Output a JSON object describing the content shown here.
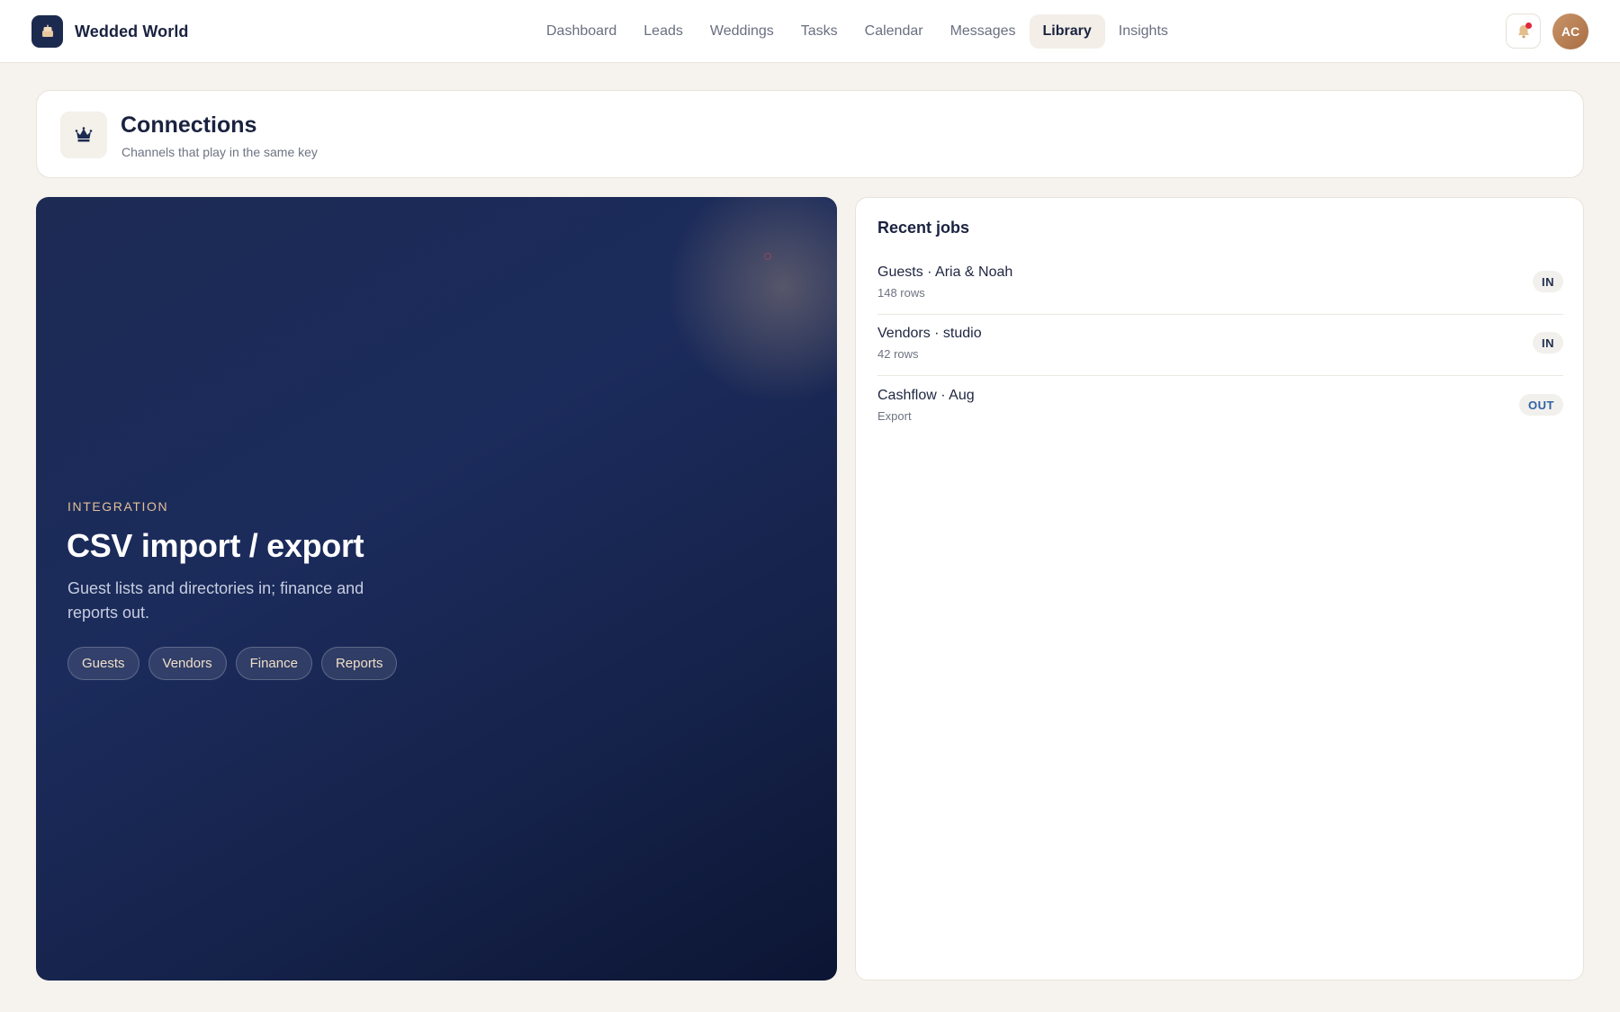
{
  "app": {
    "name": "Wedded World",
    "logo_icon": "cake-icon",
    "user_initials": "AC",
    "notification_dot_color": "#e0263a"
  },
  "nav": {
    "items": [
      {
        "label": "Dashboard",
        "active": false
      },
      {
        "label": "Leads",
        "active": false
      },
      {
        "label": "Weddings",
        "active": false
      },
      {
        "label": "Tasks",
        "active": false
      },
      {
        "label": "Calendar",
        "active": false
      },
      {
        "label": "Messages",
        "active": false
      },
      {
        "label": "Library",
        "active": true
      },
      {
        "label": "Insights",
        "active": false
      }
    ]
  },
  "page": {
    "icon": "crown-icon",
    "title": "Connections",
    "subtitle": "Channels that play in the same key"
  },
  "hero": {
    "eyebrow": "INTEGRATION",
    "title": "CSV import / export",
    "description": "Guest lists and directories in; finance and reports out.",
    "chips": [
      "Guests",
      "Vendors",
      "Finance",
      "Reports"
    ],
    "accent_color": "#e3bf98",
    "background_color": "#1b2b5b"
  },
  "jobs": {
    "title": "Recent jobs",
    "items": [
      {
        "name": "Guests · Aria & Noah",
        "meta": "148 rows",
        "direction": "IN"
      },
      {
        "name": "Vendors · studio",
        "meta": "42 rows",
        "direction": "IN"
      },
      {
        "name": "Cashflow · Aug",
        "meta": "Export",
        "direction": "OUT"
      }
    ]
  }
}
